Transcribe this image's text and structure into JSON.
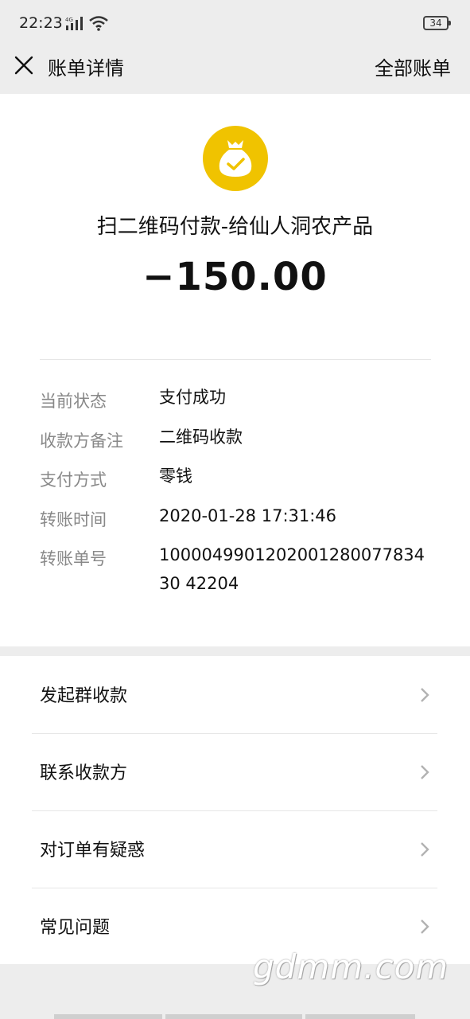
{
  "status_bar": {
    "time": "22:23",
    "network": "4G",
    "battery": "34"
  },
  "nav": {
    "title": "账单详情",
    "right_link": "全部账单"
  },
  "bill": {
    "merchant_title": "扫二维码付款-给仙人洞农产品",
    "amount": "−150.00",
    "icon": "money-bag-check-icon"
  },
  "details": [
    {
      "label": "当前状态",
      "value": "支付成功"
    },
    {
      "label": "收款方备注",
      "value": "二维码收款"
    },
    {
      "label": "支付方式",
      "value": "零钱"
    },
    {
      "label": "转账时间",
      "value": "2020-01-28 17:31:46"
    },
    {
      "label": "转账单号",
      "value": "100004990120200128007783430 42204"
    }
  ],
  "menu": [
    {
      "label": "发起群收款"
    },
    {
      "label": "联系收款方"
    },
    {
      "label": "对订单有疑惑"
    },
    {
      "label": "常见问题"
    }
  ],
  "watermark": "gdmm.com",
  "colors": {
    "accent": "#f0c300",
    "background": "#ededed"
  }
}
